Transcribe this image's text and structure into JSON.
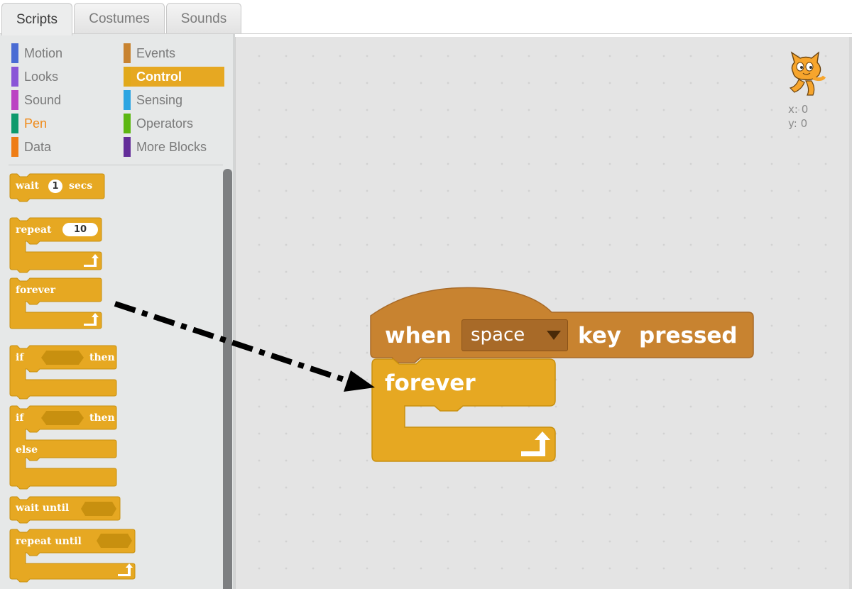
{
  "tabs": [
    {
      "label": "Scripts",
      "active": true
    },
    {
      "label": "Costumes",
      "active": false
    },
    {
      "label": "Sounds",
      "active": false
    }
  ],
  "categories": [
    {
      "label": "Motion",
      "color": "#4a6cd4"
    },
    {
      "label": "Looks",
      "color": "#8a55d7"
    },
    {
      "label": "Sound",
      "color": "#bb42c3"
    },
    {
      "label": "Pen",
      "color": "#0e9a6c"
    },
    {
      "label": "Data",
      "color": "#ee7d16"
    },
    {
      "label": "Events",
      "color": "#c88330"
    },
    {
      "label": "Control",
      "color": "#e1a91a",
      "selected": true
    },
    {
      "label": "Sensing",
      "color": "#2ca5e2"
    },
    {
      "label": "Operators",
      "color": "#5cb712"
    },
    {
      "label": "More Blocks",
      "color": "#632d99"
    }
  ],
  "palette_blocks": {
    "wait": {
      "label": "wait",
      "value": "1",
      "suffix": "secs"
    },
    "repeat": {
      "label": "repeat",
      "value": "10"
    },
    "forever": {
      "label": "forever"
    },
    "if_then": {
      "label": "if",
      "suffix": "then"
    },
    "if_else": {
      "label": "if",
      "suffix": "then",
      "else_label": "else"
    },
    "wait_until": {
      "label": "wait until"
    },
    "repeat_until": {
      "label": "repeat until"
    }
  },
  "script": {
    "hat": {
      "when": "when",
      "key": "space",
      "key_word": "key",
      "pressed": "pressed"
    },
    "forever": {
      "label": "forever"
    }
  },
  "sprite": {
    "x_label": "x:",
    "x": "0",
    "y_label": "y:",
    "y": "0"
  },
  "colors": {
    "control": "#e6a822",
    "events": "#c88330",
    "control_dark": "#c8900f",
    "events_dark": "#a86a28"
  }
}
